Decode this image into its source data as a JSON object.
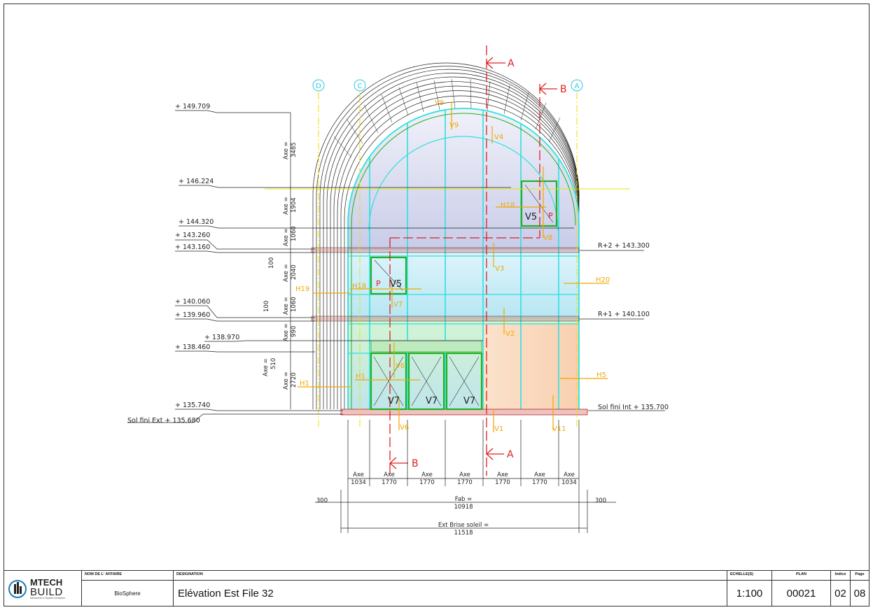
{
  "axes": {
    "bubbles": [
      "D",
      "C",
      "A"
    ]
  },
  "sections": {
    "a": "A",
    "b": "B"
  },
  "levels": {
    "left": [
      "+ 149.709",
      "+ 146.224",
      "+ 144.320",
      "+ 143.260",
      "+ 143.160",
      "+ 140.060",
      "+ 139.960",
      "+ 138.970",
      "+ 138.460",
      "+ 135.740",
      "Sol fini Ext + 135.680"
    ],
    "right": [
      "R+2 + 143.300",
      "R+1 + 140.100",
      "Sol fini Int + 135.700"
    ]
  },
  "vertical_dims": {
    "d1": {
      "axe": "Axe =",
      "val": "3485"
    },
    "d2": {
      "axe": "Axe =",
      "val": "1904"
    },
    "d3": {
      "axe": "Axe =",
      "val": "1060"
    },
    "d4": {
      "val": "100"
    },
    "d5": {
      "axe": "Axe =",
      "val": "2040"
    },
    "d6": {
      "axe": "Axe =",
      "val": "1060"
    },
    "d7": {
      "val": "100"
    },
    "d8": {
      "axe": "Axe =",
      "val": "990"
    },
    "d9": {
      "axe": "Axe =",
      "val": "510"
    },
    "d10": {
      "axe": "Axe =",
      "val": "2720"
    }
  },
  "bottom_dims": {
    "bays": [
      {
        "axe": "Axe",
        "val": "1034"
      },
      {
        "axe": "Axe",
        "val": "1770"
      },
      {
        "axe": "Axe",
        "val": "1770"
      },
      {
        "axe": "Axe",
        "val": "1770"
      },
      {
        "axe": "Axe",
        "val": "1770"
      },
      {
        "axe": "Axe",
        "val": "1770"
      },
      {
        "axe": "Axe",
        "val": "1034"
      }
    ],
    "overhang_left": "300",
    "overhang_right": "300",
    "fab_label": "Fab =",
    "fab_value": "10918",
    "ext_label": "Ext Brise soleil =",
    "ext_value": "11518"
  },
  "tags": {
    "orange": [
      "V9",
      "V9",
      "V4",
      "H18",
      "V8",
      "V3",
      "H19",
      "H18",
      "V7",
      "H20",
      "V2",
      "H1",
      "H1",
      "V6",
      "H5",
      "V6",
      "V1",
      "V11"
    ],
    "black": [
      "V5",
      "V5",
      "V7",
      "V7",
      "V7"
    ],
    "red": [
      "P",
      "P"
    ]
  },
  "colors": {
    "cyan_frame": "#2ee0e0",
    "green_frame": "#23b023",
    "orange_tag": "#f0a800",
    "section_red": "#e02020",
    "axis_yellow": "#e8e000",
    "dim_line": "#222222",
    "bubble_cyan": "#2ec8e6"
  },
  "title_block": {
    "logo_top": "MTECH",
    "logo_bottom": "BUILD",
    "logo_tagline": "Menuiseries & Façades d'exception",
    "affaire_header": "NOM DE L' AFFAIRE",
    "affaire": "BioSphere",
    "designation_header": "DESIGNATION",
    "designation": "Elévation Est File 32",
    "echelle_header": "ECHELLE(S)",
    "echelle": "1:100",
    "plan_header": "PLAN",
    "plan": "00021",
    "indice_header": "Indice",
    "indice": "02",
    "page_header": "Page",
    "page": "08"
  }
}
